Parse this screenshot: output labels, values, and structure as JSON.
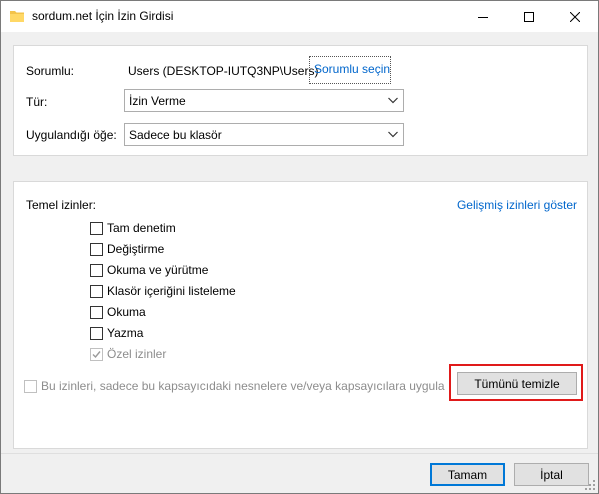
{
  "window": {
    "title": "sordum.net İçin İzin Girdisi",
    "icons": {
      "app": "folder-icon",
      "minimize": "minimize-icon",
      "maximize": "maximize-icon",
      "close": "close-icon"
    }
  },
  "top_panel": {
    "owner_label": "Sorumlu:",
    "owner_value": "Users (DESKTOP-IUTQ3NP\\Users)",
    "owner_link": "Sorumlu seçin",
    "type_label": "Tür:",
    "type_value": "İzin Verme",
    "applies_label": "Uygulandığı öğe:",
    "applies_value": "Sadece bu klasör"
  },
  "permissions_panel": {
    "heading": "Temel izinler:",
    "advanced_link": "Gelişmiş izinleri göster",
    "items": [
      {
        "label": "Tam denetim",
        "checked": false,
        "disabled": false
      },
      {
        "label": "Değiştirme",
        "checked": false,
        "disabled": false
      },
      {
        "label": "Okuma ve yürütme",
        "checked": false,
        "disabled": false
      },
      {
        "label": "Klasör içeriğini listeleme",
        "checked": false,
        "disabled": false
      },
      {
        "label": "Okuma",
        "checked": false,
        "disabled": false
      },
      {
        "label": "Yazma",
        "checked": false,
        "disabled": false
      },
      {
        "label": "Özel izinler",
        "checked": true,
        "disabled": true
      }
    ],
    "apply_only_label": "Bu izinleri, sadece bu kapsayıcıdaki nesnelere ve/veya kapsayıcılara uygula",
    "clear_all_button": "Tümünü temizle"
  },
  "footer": {
    "ok_button": "Tamam",
    "cancel_button": "İptal"
  },
  "colors": {
    "link": "#0066cc",
    "highlight": "#e01a1a",
    "accent": "#0078d7"
  }
}
